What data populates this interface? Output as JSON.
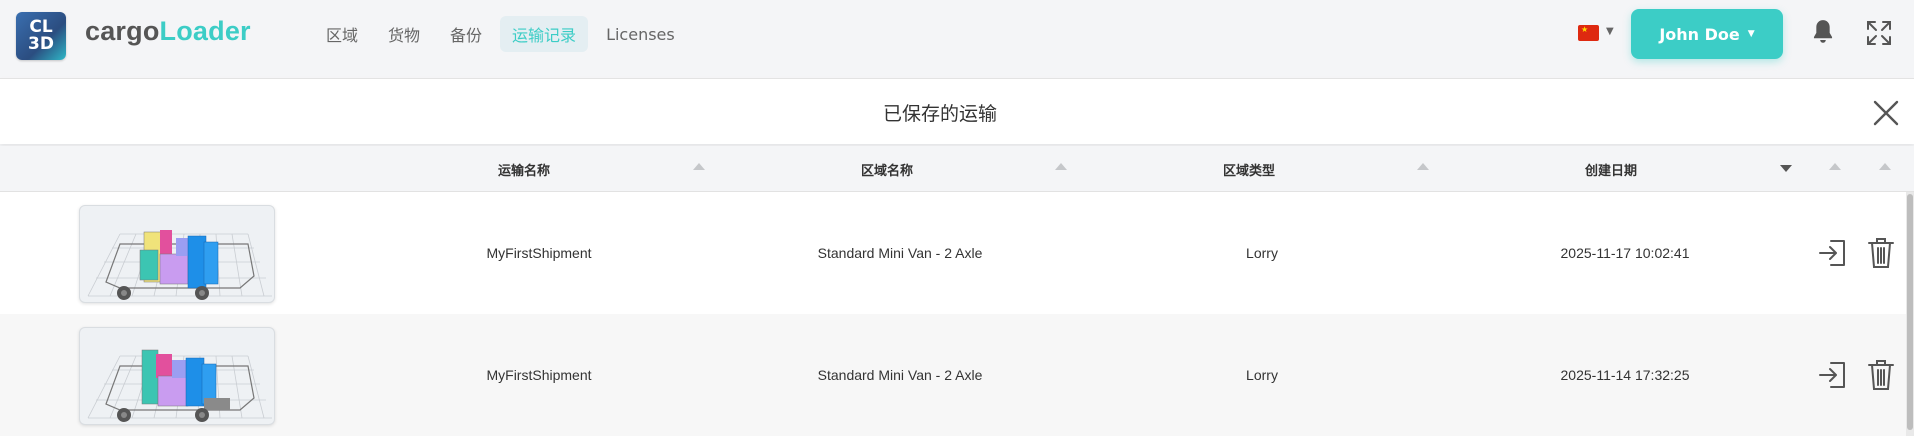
{
  "brand": {
    "logo_text": [
      "CL",
      "3D"
    ],
    "part1": "cargo",
    "part2": "Loader"
  },
  "nav": [
    {
      "label": "区域",
      "active": false
    },
    {
      "label": "货物",
      "active": false
    },
    {
      "label": "备份",
      "active": false
    },
    {
      "label": "运输记录",
      "active": true
    },
    {
      "label": "Licenses",
      "active": false
    }
  ],
  "language_flag": "china-flag-icon",
  "user": {
    "name": "John Doe"
  },
  "panel": {
    "title": "已保存的运输"
  },
  "table": {
    "headers": [
      "运输名称",
      "区域名称",
      "区域类型",
      "创建日期"
    ],
    "sort_active": "创建日期",
    "rows": [
      {
        "name": "MyFirstShipment",
        "area_name": "Standard Mini Van - 2 Axle",
        "area_type": "Lorry",
        "created": "2025-11-17 10:02:41"
      },
      {
        "name": "MyFirstShipment",
        "area_name": "Standard Mini Van - 2 Axle",
        "area_type": "Lorry",
        "created": "2025-11-14 17:32:25"
      }
    ]
  },
  "colors": {
    "accent": "#3ccdc6",
    "nav_bg": "#f4f5f7",
    "row_alt": "#f7f7f7"
  }
}
